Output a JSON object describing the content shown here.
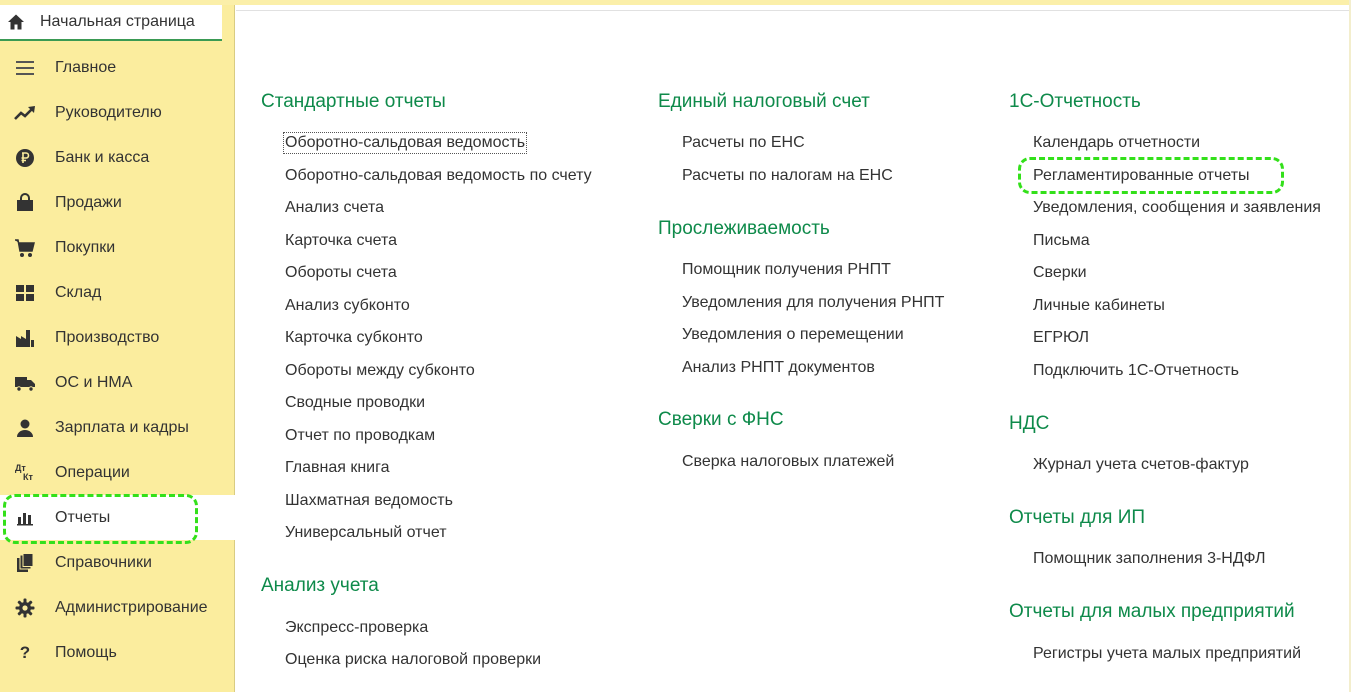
{
  "sidebar": {
    "home": {
      "label": "Начальная страница",
      "icon": "home-icon"
    },
    "items": [
      {
        "label": "Главное",
        "icon": "menu-icon"
      },
      {
        "label": "Руководителю",
        "icon": "trend-icon"
      },
      {
        "label": "Банк и касса",
        "icon": "ruble-coin-icon"
      },
      {
        "label": "Продажи",
        "icon": "shopping-bag-icon"
      },
      {
        "label": "Покупки",
        "icon": "cart-icon"
      },
      {
        "label": "Склад",
        "icon": "warehouse-grid-icon"
      },
      {
        "label": "Производство",
        "icon": "factory-icon"
      },
      {
        "label": "ОС и НМА",
        "icon": "truck-icon"
      },
      {
        "label": "Зарплата и кадры",
        "icon": "person-icon"
      },
      {
        "label": "Операции",
        "icon": "debit-credit-icon",
        "icon_text": [
          "Дт",
          "Кт"
        ]
      },
      {
        "label": "Отчеты",
        "icon": "bar-chart-icon",
        "active": true
      },
      {
        "label": "Справочники",
        "icon": "books-icon"
      },
      {
        "label": "Администрирование",
        "icon": "gear-icon"
      },
      {
        "label": "Помощь",
        "icon": "help-icon",
        "icon_text": "?"
      }
    ]
  },
  "columns": [
    {
      "sections": [
        {
          "title": "Стандартные отчеты",
          "links": [
            "Оборотно-сальдовая ведомость",
            "Оборотно-сальдовая ведомость по счету",
            "Анализ счета",
            "Карточка счета",
            "Обороты счета",
            "Анализ субконто",
            "Карточка субконто",
            "Обороты между субконто",
            "Сводные проводки",
            "Отчет по проводкам",
            "Главная книга",
            "Шахматная ведомость",
            "Универсальный отчет"
          ]
        },
        {
          "title": "Анализ учета",
          "links": [
            "Экспресс-проверка",
            "Оценка риска налоговой проверки"
          ]
        }
      ]
    },
    {
      "sections": [
        {
          "title": "Единый налоговый счет",
          "links": [
            "Расчеты по ЕНС",
            "Расчеты по налогам на ЕНС"
          ]
        },
        {
          "title": "Прослеживаемость",
          "links": [
            "Помощник получения РНПТ",
            "Уведомления для получения РНПТ",
            "Уведомления о перемещении",
            "Анализ РНПТ документов"
          ]
        },
        {
          "title": "Сверки с ФНС",
          "links": [
            "Сверка налоговых платежей"
          ]
        }
      ]
    },
    {
      "sections": [
        {
          "title": "1С-Отчетность",
          "links": [
            "Календарь отчетности",
            "Регламентированные отчеты",
            "Уведомления, сообщения и заявления",
            "Письма",
            "Сверки",
            "Личные кабинеты",
            "ЕГРЮЛ",
            "Подключить 1С-Отчетность"
          ]
        },
        {
          "title": "НДС",
          "links": [
            "Журнал учета счетов-фактур"
          ]
        },
        {
          "title": "Отчеты для ИП",
          "links": [
            "Помощник заполнения 3-НДФЛ"
          ]
        },
        {
          "title": "Отчеты для малых предприятий",
          "links": [
            "Регистры учета малых предприятий"
          ]
        }
      ]
    }
  ],
  "colors": {
    "sidebar_bg": "#fbed9e",
    "heading_green": "#0e8a4a",
    "highlight_green": "#33e01a",
    "text": "#333333"
  }
}
